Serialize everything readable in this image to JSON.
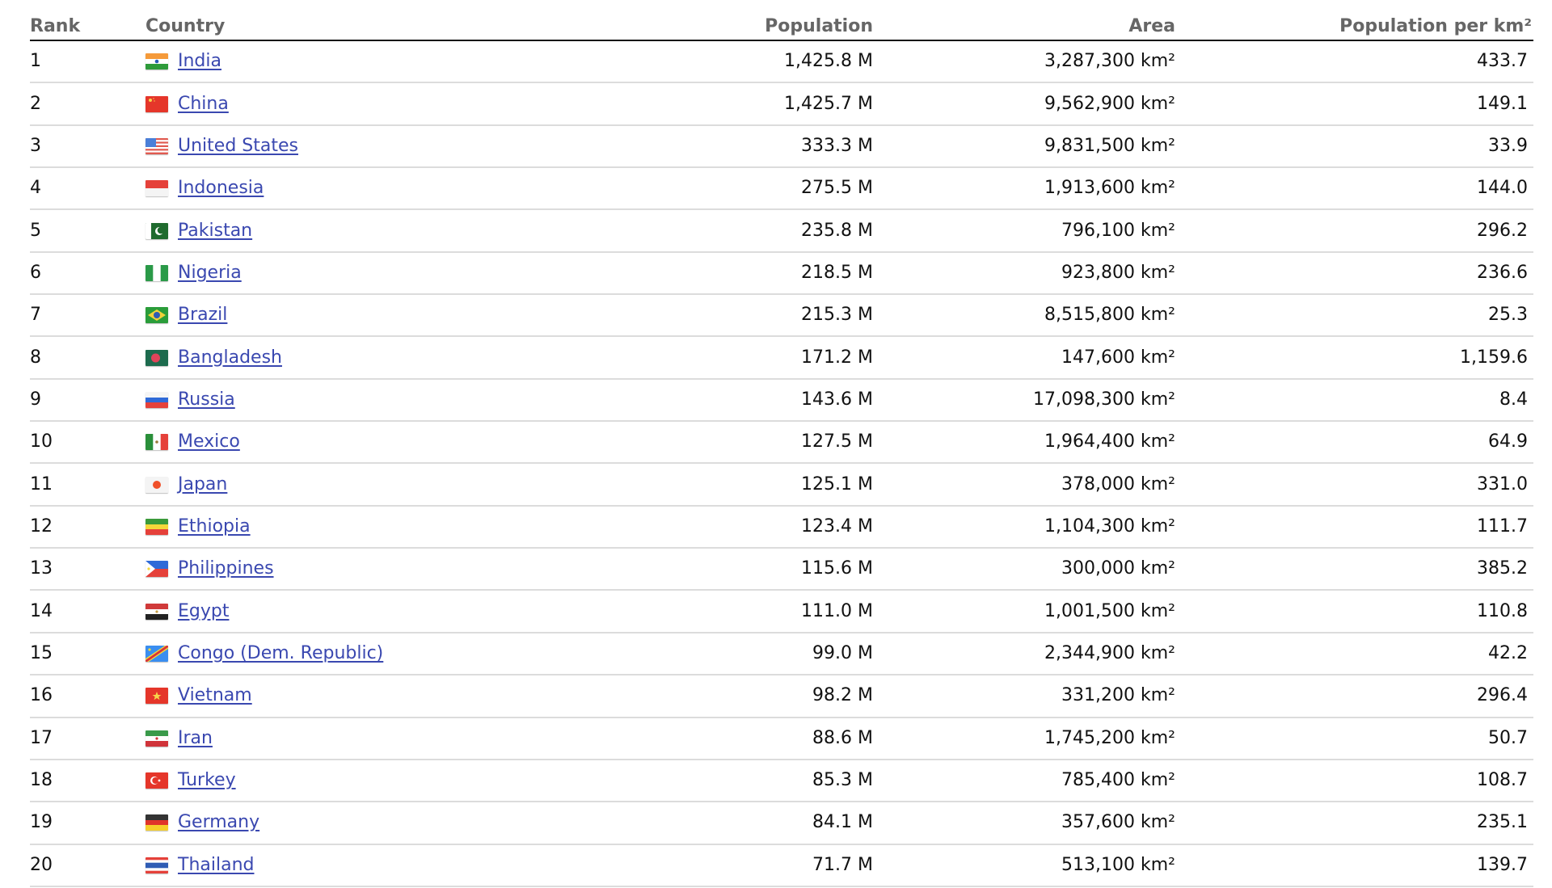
{
  "table": {
    "headers": {
      "rank": "Rank",
      "country": "Country",
      "population": "Population",
      "area": "Area",
      "density": "Population per km²"
    },
    "rows": [
      {
        "rank": "1",
        "country": "India",
        "flag": "india-flag",
        "population": "1,425.8 M",
        "area": "3,287,300 km²",
        "density": "433.7"
      },
      {
        "rank": "2",
        "country": "China",
        "flag": "china-flag",
        "population": "1,425.7 M",
        "area": "9,562,900 km²",
        "density": "149.1"
      },
      {
        "rank": "3",
        "country": "United States",
        "flag": "united-states-flag",
        "population": "333.3 M",
        "area": "9,831,500 km²",
        "density": "33.9"
      },
      {
        "rank": "4",
        "country": "Indonesia",
        "flag": "indonesia-flag",
        "population": "275.5 M",
        "area": "1,913,600 km²",
        "density": "144.0"
      },
      {
        "rank": "5",
        "country": "Pakistan",
        "flag": "pakistan-flag",
        "population": "235.8 M",
        "area": "796,100 km²",
        "density": "296.2"
      },
      {
        "rank": "6",
        "country": "Nigeria",
        "flag": "nigeria-flag",
        "population": "218.5 M",
        "area": "923,800 km²",
        "density": "236.6"
      },
      {
        "rank": "7",
        "country": "Brazil",
        "flag": "brazil-flag",
        "population": "215.3 M",
        "area": "8,515,800 km²",
        "density": "25.3"
      },
      {
        "rank": "8",
        "country": "Bangladesh",
        "flag": "bangladesh-flag",
        "population": "171.2 M",
        "area": "147,600 km²",
        "density": "1,159.6"
      },
      {
        "rank": "9",
        "country": "Russia",
        "flag": "russia-flag",
        "population": "143.6 M",
        "area": "17,098,300 km²",
        "density": "8.4"
      },
      {
        "rank": "10",
        "country": "Mexico",
        "flag": "mexico-flag",
        "population": "127.5 M",
        "area": "1,964,400 km²",
        "density": "64.9"
      },
      {
        "rank": "11",
        "country": "Japan",
        "flag": "japan-flag",
        "population": "125.1 M",
        "area": "378,000 km²",
        "density": "331.0"
      },
      {
        "rank": "12",
        "country": "Ethiopia",
        "flag": "ethiopia-flag",
        "population": "123.4 M",
        "area": "1,104,300 km²",
        "density": "111.7"
      },
      {
        "rank": "13",
        "country": "Philippines",
        "flag": "philippines-flag",
        "population": "115.6 M",
        "area": "300,000 km²",
        "density": "385.2"
      },
      {
        "rank": "14",
        "country": "Egypt",
        "flag": "egypt-flag",
        "population": "111.0 M",
        "area": "1,001,500 km²",
        "density": "110.8"
      },
      {
        "rank": "15",
        "country": "Congo (Dem. Republic)",
        "flag": "dr-congo-flag",
        "population": "99.0 M",
        "area": "2,344,900 km²",
        "density": "42.2"
      },
      {
        "rank": "16",
        "country": "Vietnam",
        "flag": "vietnam-flag",
        "population": "98.2 M",
        "area": "331,200 km²",
        "density": "296.4"
      },
      {
        "rank": "17",
        "country": "Iran",
        "flag": "iran-flag",
        "population": "88.6 M",
        "area": "1,745,200 km²",
        "density": "50.7"
      },
      {
        "rank": "18",
        "country": "Turkey",
        "flag": "turkey-flag",
        "population": "85.3 M",
        "area": "785,400 km²",
        "density": "108.7"
      },
      {
        "rank": "19",
        "country": "Germany",
        "flag": "germany-flag",
        "population": "84.1 M",
        "area": "357,600 km²",
        "density": "235.1"
      },
      {
        "rank": "20",
        "country": "Thailand",
        "flag": "thailand-flag",
        "population": "71.7 M",
        "area": "513,100 km²",
        "density": "139.7"
      }
    ]
  },
  "colors": {
    "link": "#3a48b0",
    "header_text": "#666666",
    "body_text": "#111111",
    "divider": "#dcdcdc",
    "header_rule": "#111111"
  }
}
